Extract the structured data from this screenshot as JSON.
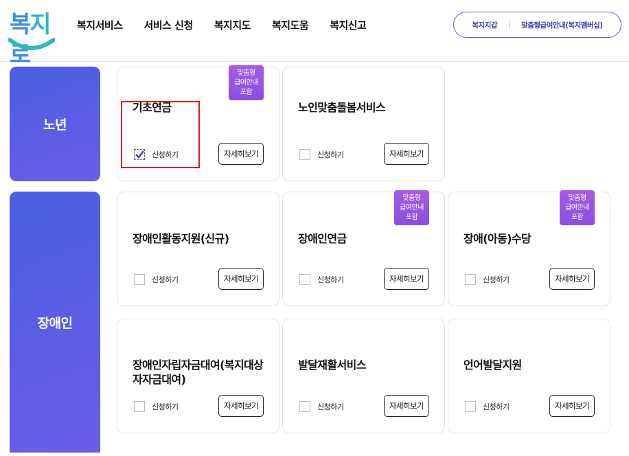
{
  "logo": {
    "text_part1": "복",
    "text_part2": "지",
    "text_part3": "로"
  },
  "nav": [
    "복지서비스",
    "서비스 신청",
    "복지지도",
    "복지도움",
    "복지신고"
  ],
  "header_links": {
    "wallet": "복지지갑",
    "membership": "맞춤형급여안내(복지멤버십)"
  },
  "categories": [
    {
      "name": "노년",
      "cards": [
        {
          "title": "기초연금",
          "badge": "맞춤형\n급여안내\n포함",
          "apply_label": "신청하기",
          "detail_label": "자세히보기",
          "checked": true
        },
        {
          "title": "노인맞춤돌봄서비스",
          "badge": "",
          "apply_label": "신청하기",
          "detail_label": "자세히보기",
          "checked": false
        }
      ]
    },
    {
      "name": "장애인",
      "cards": [
        {
          "title": "장애인활동지원(신규)",
          "badge": "",
          "apply_label": "신청하기",
          "detail_label": "자세히보기",
          "checked": false
        },
        {
          "title": "장애인연금",
          "badge": "맞춤형\n급여안내\n포함",
          "apply_label": "신청하기",
          "detail_label": "자세히보기",
          "checked": false
        },
        {
          "title": "장애(아동)수당",
          "badge": "맞춤형\n급여안내\n포함",
          "apply_label": "신청하기",
          "detail_label": "자세히보기",
          "checked": false
        },
        {
          "title": "장애인자립자금대여(복지대상자자금대여)",
          "badge": "",
          "apply_label": "신청하기",
          "detail_label": "자세히보기",
          "checked": false
        },
        {
          "title": "발달재활서비스",
          "badge": "",
          "apply_label": "신청하기",
          "detail_label": "자세히보기",
          "checked": false
        },
        {
          "title": "언어발달지원",
          "badge": "",
          "apply_label": "신청하기",
          "detail_label": "자세히보기",
          "checked": false
        }
      ]
    }
  ],
  "colors": {
    "accent": "#5c5ee0",
    "badge": "#9b55e2",
    "highlight": "#e01818",
    "logo_blue": "#3a8fd8"
  },
  "icons": {
    "checkbox_checked": "check-icon"
  }
}
